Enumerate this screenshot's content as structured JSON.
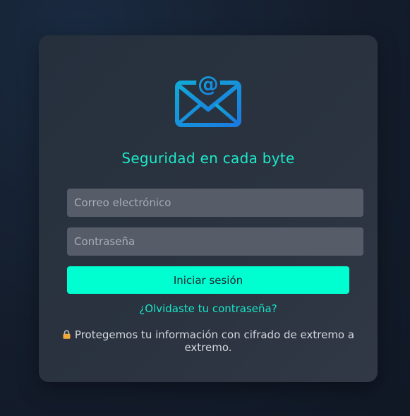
{
  "header": {
    "title": "Seguridad en cada byte",
    "logo_icon": "envelope-at-icon"
  },
  "form": {
    "email_placeholder": "Correo electrónico",
    "password_placeholder": "Contraseña",
    "submit_label": "Iniciar sesión",
    "forgot_label": "¿Olvidaste tu contraseña?"
  },
  "footer": {
    "notice_icon": "lock-icon",
    "notice_text": "Protegemos tu información con cifrado de extremo a extremo."
  },
  "colors": {
    "accent": "#00ffd0",
    "title": "#1de9c8",
    "logo": "#1a8fe0",
    "card": "#2b3340",
    "input": "#565c68"
  }
}
